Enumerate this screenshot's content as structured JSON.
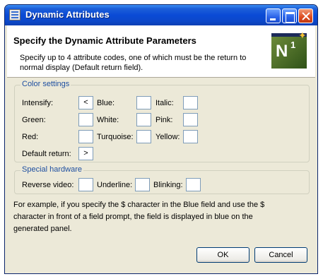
{
  "window": {
    "title": "Dynamic Attributes",
    "icon": "app-window-icon",
    "controls": [
      "minimize-icon",
      "maximize-icon",
      "close-icon"
    ]
  },
  "header": {
    "title": "Specify the Dynamic Attribute Parameters",
    "description": "Specify up to 4 attribute codes, one of which must be the return to normal display (Default return field).",
    "logo_text": "N",
    "logo_sup": "1",
    "logo_star": "✦"
  },
  "color_settings": {
    "legend": "Color settings",
    "intensify": {
      "label": "Intensify:",
      "value": "<"
    },
    "blue": {
      "label": "Blue:",
      "value": ""
    },
    "italic": {
      "label": "Italic:",
      "value": ""
    },
    "green": {
      "label": "Green:",
      "value": ""
    },
    "white": {
      "label": "White:",
      "value": ""
    },
    "pink": {
      "label": "Pink:",
      "value": ""
    },
    "red": {
      "label": "Red:",
      "value": ""
    },
    "turquoise": {
      "label": "Turquoise:",
      "value": ""
    },
    "yellow": {
      "label": "Yellow:",
      "value": ""
    },
    "default_return": {
      "label": "Default return:",
      "value": ">"
    }
  },
  "special_hardware": {
    "legend": "Special hardware",
    "reverse_video": {
      "label": "Reverse video:",
      "value": ""
    },
    "underline": {
      "label": "Underline:",
      "value": ""
    },
    "blinking": {
      "label": "Blinking:",
      "value": ""
    }
  },
  "note": "For example, if you specify the $ character in the Blue field and use the $ character in front of a field prompt, the field is displayed in blue on the generated panel.",
  "buttons": {
    "ok": "OK",
    "cancel": "Cancel"
  }
}
